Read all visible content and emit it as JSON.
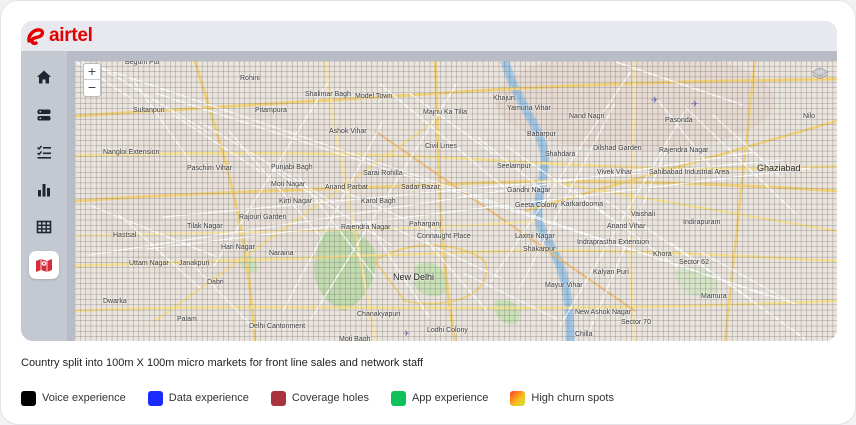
{
  "brand": {
    "name": "airtel",
    "color": "#e40000"
  },
  "sidebar": {
    "items": [
      {
        "icon": "home-icon",
        "active": false
      },
      {
        "icon": "storage-icon",
        "active": false
      },
      {
        "icon": "checklist-icon",
        "active": false
      },
      {
        "icon": "bar-chart-icon",
        "active": false
      },
      {
        "icon": "table-icon",
        "active": false
      },
      {
        "icon": "map-icon",
        "active": true
      }
    ]
  },
  "map": {
    "zoom_in": "+",
    "zoom_out": "−",
    "places": [
      "Begum Pur",
      "Rohini",
      "Pitampura",
      "Shalimar Bagh",
      "Model Town",
      "Sultanpuri",
      "Majnu Ka Tilla",
      "Khajuri",
      "Yamuna Vihar",
      "Nand Nagri",
      "Pasonda",
      "Ashok Vihar",
      "Babarpur",
      "Civil Lines",
      "Nangloi Extension",
      "Shahdara",
      "Dilshad Garden",
      "Rajendra Nagar",
      "Paschim Vihar",
      "Punjabi Bagh",
      "Sarai Rohilla",
      "Seelampur",
      "Vivek Vihar",
      "Sahibabad Industrial Area",
      "Ghaziabad",
      "Moti Nagar",
      "Anand Parbat",
      "Sadar Bazar",
      "Gandhi Nagar",
      "Kirti Nagar",
      "Karol Bagh",
      "Geeta Colony",
      "Karkardooma",
      "Vaishali",
      "Rajouri Garden",
      "Tilak Nagar",
      "Rajendra Nagar",
      "Paharganj",
      "Connaught Place",
      "Laxmi Nagar",
      "Anand Vihar",
      "Indirapuram",
      "Hastsal",
      "Hari Nagar",
      "Shakarpur",
      "Indraprastha Extension",
      "Uttam Nagar",
      "Janakpuri",
      "Naraina",
      "New Delhi",
      "Khora",
      "Sector 62",
      "Kalyan Puri",
      "Dabri",
      "Mayur Vihar",
      "Dwarka",
      "Mamura",
      "Palam",
      "Delhi Cantonment",
      "Chanakyapuri",
      "New Ashok Nagar",
      "Sector 70",
      "Lodhi Colony",
      "Chilla",
      "Moti Bagh",
      "Nilo"
    ]
  },
  "caption": "Country split into 100m X 100m micro markets for front line sales and network staff",
  "legend": [
    {
      "label": "Voice experience",
      "color": "#000000"
    },
    {
      "label": "Data experience",
      "color": "#1a2bff"
    },
    {
      "label": "Coverage holes",
      "color": "#a8353c"
    },
    {
      "label": "App experience",
      "color": "#10c15a"
    },
    {
      "label": "High churn spots",
      "color": "#f7c21c"
    }
  ]
}
